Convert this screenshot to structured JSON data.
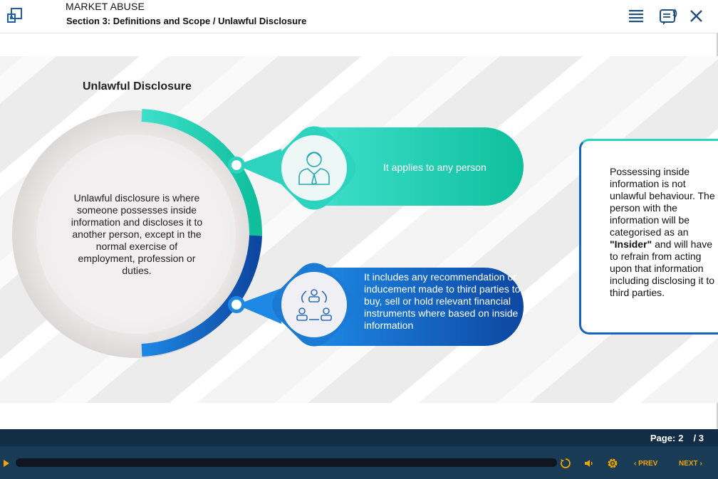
{
  "header": {
    "course_title": "MARKET ABUSE",
    "section_title": "Section 3: Definitions and Scope / Unlawful Disclosure",
    "icons": {
      "logo": "expand-window-icon",
      "menu": "hamburger-menu-icon",
      "transcript": "transcript-icon",
      "close": "close-icon"
    }
  },
  "content": {
    "heading": "Unlawful Disclosure",
    "circle_text": "Unlawful disclosure is where someone possesses inside information and discloses it to another person, except in the normal exercise of employment, profession or duties.",
    "points": [
      {
        "text": "It applies to any person",
        "icon": "businessman-icon"
      },
      {
        "text": "It includes any recommendation or inducement made to third parties to buy, sell or hold relevant financial instruments where based on inside information",
        "icon": "people-exchange-icon"
      }
    ],
    "side_note": {
      "text_before": "Possessing inside information is not unlawful behaviour. The person with the information will be categorised as an ",
      "highlight": "\"Insider\"",
      "text_after": " and will have to refrain from acting upon that information including disclosing it to third parties."
    },
    "colors": {
      "teal": "#2ed3c0",
      "teal_dark": "#13b8a5",
      "blue": "#1565c0",
      "blue_light": "#1e88e5"
    }
  },
  "footer": {
    "page_label": "Page:",
    "page_current": "2",
    "page_total": "/ 3",
    "prev_label": "‹ PREV",
    "next_label": "NEXT ›",
    "accent": "#f0a500"
  }
}
